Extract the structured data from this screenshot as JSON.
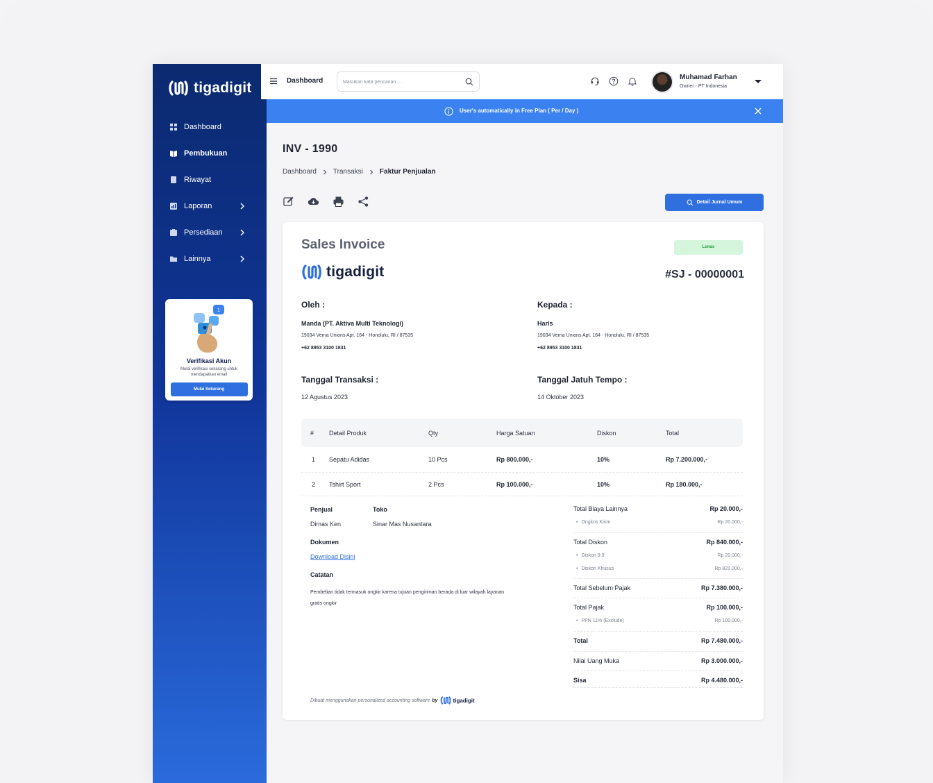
{
  "brand": {
    "name": "tigadigit"
  },
  "sidebar": {
    "items": [
      {
        "label": "Dashboard",
        "icon": "grid-icon"
      },
      {
        "label": "Pembukuan",
        "icon": "book-icon",
        "active": true
      },
      {
        "label": "Riwayat",
        "icon": "history-icon"
      },
      {
        "label": "Laporan",
        "icon": "report-icon",
        "chevron": true
      },
      {
        "label": "Persediaan",
        "icon": "box-icon",
        "chevron": true
      },
      {
        "label": "Lainnya",
        "icon": "folder-icon",
        "chevron": true
      }
    ],
    "verify": {
      "title": "Verifikasi Akun",
      "desc": "Mulai verifikasi sekarang untuk mendapatkan email",
      "button": "Mulai Sekarang"
    }
  },
  "header": {
    "title": "Dashboard",
    "search_placeholder": "Masukan kata pencarian ...",
    "user_name": "Muhamad Farhan",
    "user_role": "Owner - PT Indonesia"
  },
  "banner": {
    "text": "User's automatically in Free Plan ( Per / Day )"
  },
  "page": {
    "title": "INV - 1990",
    "breadcrumb": [
      "Dashboard",
      "Transaksi",
      "Faktur Penjualan"
    ],
    "jurnal_button": "Detail Jurnal Umum"
  },
  "invoice": {
    "title": "Sales Invoice",
    "status": "Lunas",
    "number": "#SJ - 00000001",
    "from_label": "Oleh :",
    "to_label": "Kepada :",
    "from": {
      "name": "Manda (PT. Aktiva Multi Teknologi)",
      "address": "19034 Verna Unions Apt. 164 - Honolulu, RI / 87535",
      "phone": "+62 8953 3100 1831"
    },
    "to": {
      "name": "Haris",
      "address": "19034 Verna Unions Apt. 164 - Honolulu, RI / 87535",
      "phone": "+62 8953 3100 1831"
    },
    "date_label": "Tanggal Transaksi :",
    "date": "12 Agustus 2023",
    "due_label": "Tanggal Jatuh Tempo :",
    "due": "14 Oktober 2023",
    "columns": [
      "#",
      "Detail Produk",
      "Qty",
      "Harga Satuan",
      "Diskon",
      "Total"
    ],
    "rows": [
      [
        "1",
        "Sepatu Adidas",
        "10 Pcs",
        "Rp 800.000,-",
        "10%",
        "Rp 7.200.000,-"
      ],
      [
        "2",
        "Tshirt Sport",
        "2 Pcs",
        "Rp 100.000,-",
        "10%",
        "Rp 180.000,-"
      ]
    ],
    "seller_label": "Penjual",
    "seller": "Dimas Ken",
    "store_label": "Toko",
    "store": "Sinar Mas Nusantara",
    "doc_label": "Dokumen",
    "doc_link": "Download Disini",
    "notes_label": "Catatan",
    "notes": "Pembelian tidak termasuk ongkir karena tujuan pengiriman berada di luar wilayah layanan gratis ongkir",
    "summary": {
      "other_label": "Total Biaya Lainnya",
      "other": "Rp 20.000,-",
      "shipping_label": "Ongkos Kirim",
      "shipping": "Rp 20.000,-",
      "discount_label": "Total Diskon",
      "discount": "Rp 840.000,-",
      "disc1_label": "Diskon 9.9",
      "disc1": "Rp 20.000,-",
      "disc2_label": "Diskon Khusus",
      "disc2": "Rp 820.000,-",
      "pretax_label": "Total Sebelum Pajak",
      "pretax": "Rp 7.380.000,-",
      "tax_label": "Total Pajak",
      "tax": "Rp 100.000,-",
      "ppn_label": "PPN 11% (Exclude)",
      "ppn": "Rp 100.000,-",
      "total_label": "Total",
      "total": "Rp 7.480.000,-",
      "dp_label": "Nilai Uang Muka",
      "dp": "Rp 3.000.000,-",
      "rest_label": "Sisa",
      "rest": "Rp 4.480.000,-"
    },
    "footer_note": "Dibuat menggunakan personalized accounting software",
    "footer_by": "by",
    "footer_brand": "tigadigit"
  }
}
